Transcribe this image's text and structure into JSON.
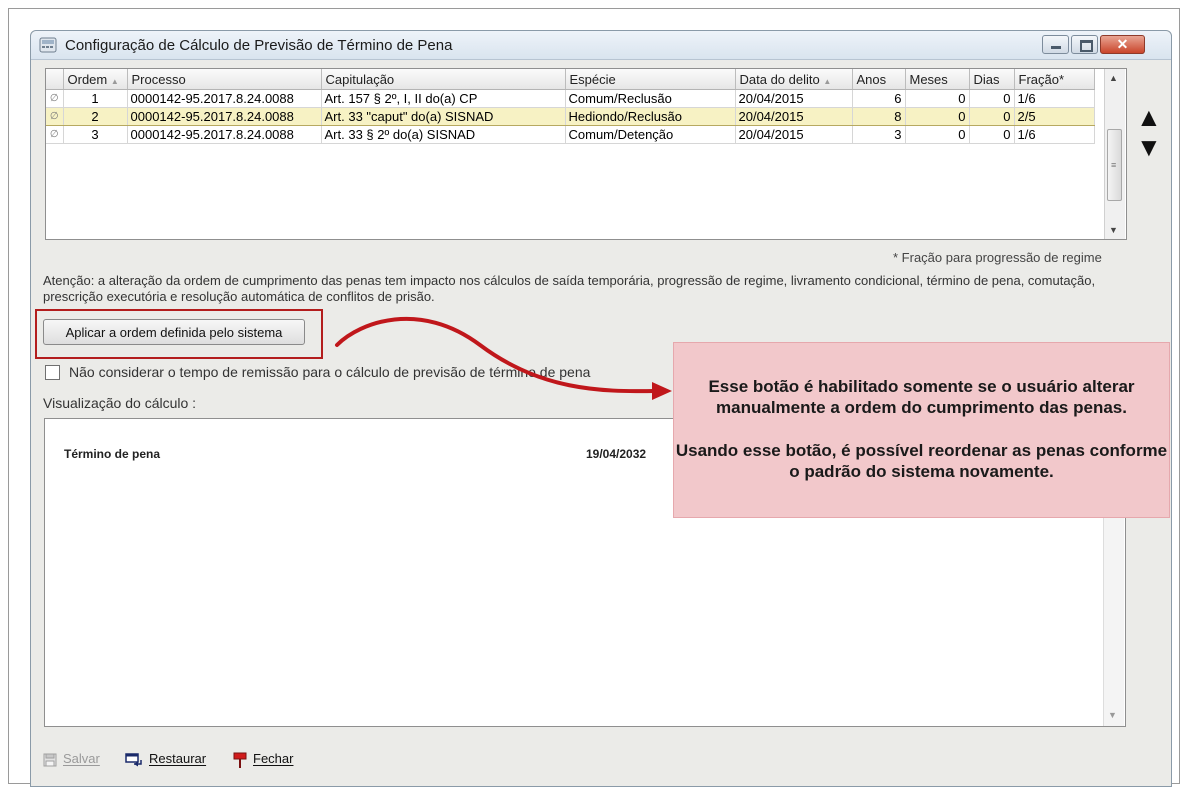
{
  "window": {
    "title": "Configuração de Cálculo de Previsão de Término de Pena",
    "close_glyph": "✕"
  },
  "grid": {
    "columns": [
      "Ordem",
      "Processo",
      "Capitulação",
      "Espécie",
      "Data do delito",
      "Anos",
      "Meses",
      "Dias",
      "Fração*"
    ],
    "sort_glyph": "▲",
    "rows": [
      {
        "indicator": "∅",
        "ordem": "1",
        "processo": "0000142-95.2017.8.24.0088",
        "capitulacao": "Art. 157 § 2º, I, II do(a) CP",
        "especie": "Comum/Reclusão",
        "data": "20/04/2015",
        "anos": "6",
        "meses": "0",
        "dias": "0",
        "fracao": "1/6",
        "selected": false
      },
      {
        "indicator": "∅",
        "ordem": "2",
        "processo": "0000142-95.2017.8.24.0088",
        "capitulacao": "Art. 33 \"caput\" do(a) SISNAD",
        "especie": "Hediondo/Reclusão",
        "data": "20/04/2015",
        "anos": "8",
        "meses": "0",
        "dias": "0",
        "fracao": "2/5",
        "selected": true
      },
      {
        "indicator": "∅",
        "ordem": "3",
        "processo": "0000142-95.2017.8.24.0088",
        "capitulacao": "Art. 33 § 2º do(a) SISNAD",
        "especie": "Comum/Detenção",
        "data": "20/04/2015",
        "anos": "3",
        "meses": "0",
        "dias": "0",
        "fracao": "1/6",
        "selected": false
      }
    ],
    "scroll_up": "▲",
    "scroll_down": "▼",
    "scroll_grip": "≡"
  },
  "move_up_glyph": "▲",
  "move_down_glyph": "▼",
  "fraction_note": "* Fração para progressão de regime",
  "attention_text": "Atenção: a alteração da ordem de cumprimento das penas tem impacto nos cálculos de saída temporária, progressão de regime, livramento condicional, término de pena, comutação, prescrição executória e resolução automática de conflitos de prisão.",
  "apply_button": "Aplicar a ordem definida pelo sistema",
  "ignore_remission_checkbox": {
    "label": "Não considerar o tempo de remissão para o cálculo de previsão de término de pena",
    "checked": false
  },
  "visualization_label": "Visualização do cálculo :",
  "calculation": {
    "label": "Término de pena",
    "date": "19/04/2032",
    "scroll_down": "▼"
  },
  "footer": {
    "save": "Salvar",
    "restore": "Restaurar",
    "close": "Fechar"
  },
  "callout": {
    "line1": "Esse botão é habilitado somente se o usuário alterar manualmente a ordem do cumprimento das penas.",
    "line2": "Usando esse botão, é possível reordenar as penas conforme o padrão do sistema novamente."
  },
  "colors": {
    "selected_row": "#f7f2c4",
    "highlight_border": "#b31d1d",
    "callout_bg": "#f2c8cb"
  }
}
